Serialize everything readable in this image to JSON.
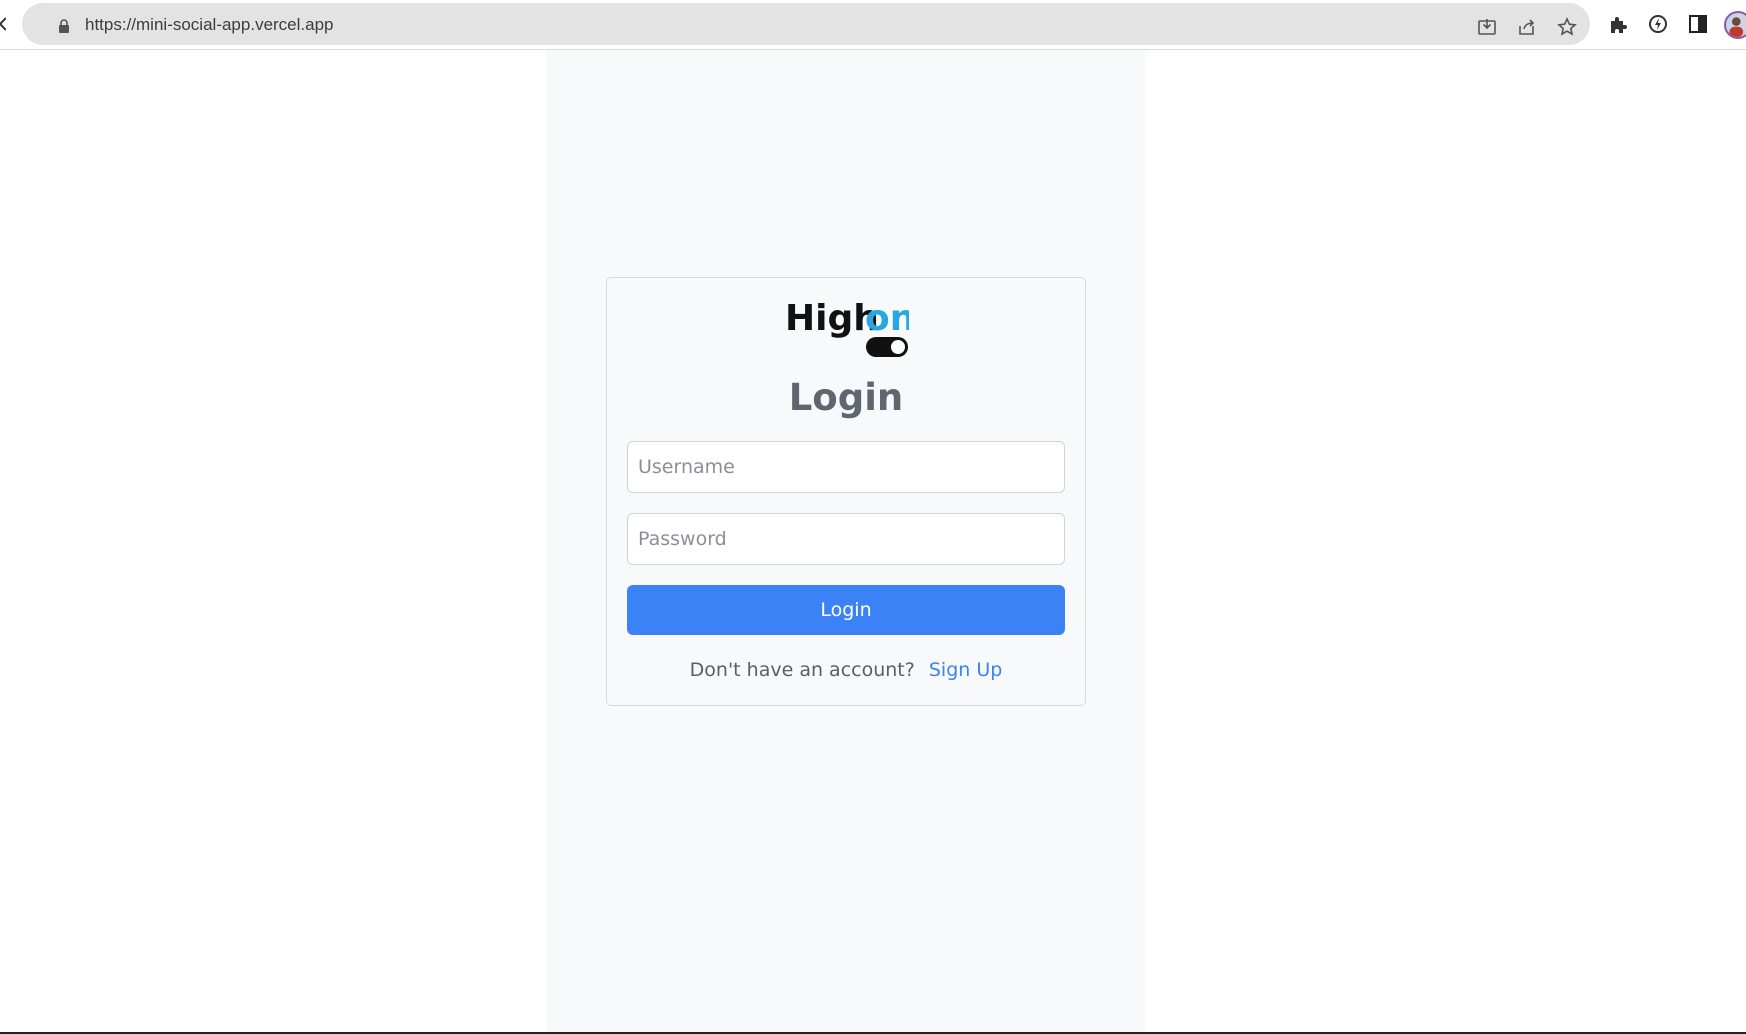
{
  "browser": {
    "url": "https://mini-social-app.vercel.app"
  },
  "logo": {
    "text_part1": "High",
    "text_part2": "on",
    "accent_color": "#29a8e0"
  },
  "login_form": {
    "title": "Login",
    "username_placeholder": "Username",
    "password_placeholder": "Password",
    "submit_label": "Login",
    "signup_prompt": "Don't have an account?",
    "signup_link": "Sign Up"
  },
  "colors": {
    "primary": "#3b82f6",
    "column_bg": "#f8f9fa"
  }
}
